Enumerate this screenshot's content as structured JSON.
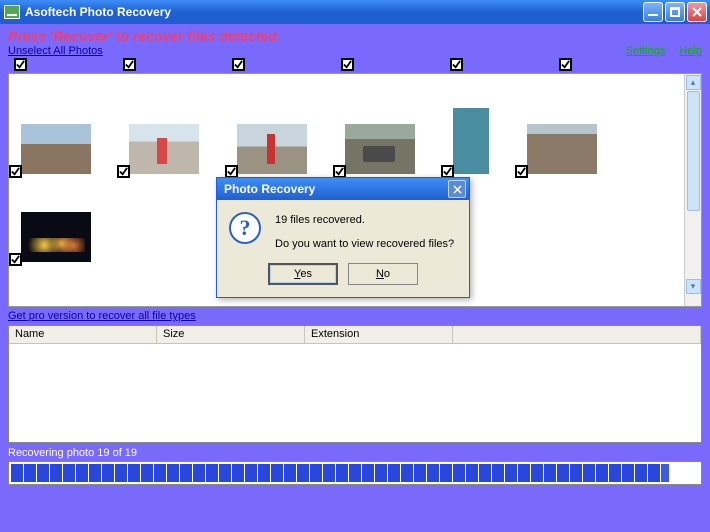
{
  "window": {
    "title": "Asoftech Photo Recovery"
  },
  "main": {
    "instruction": "Press 'Recover' to recover files detected.",
    "unselect_link": "Unselect All Photos",
    "settings_link": "Settings",
    "help_link": "Help",
    "pro_link": "Get pro version to recover all file types"
  },
  "grid": {
    "col_name": "Name",
    "col_size": "Size",
    "col_ext": "Extension"
  },
  "status": {
    "text": "Recovering photo 19 of 19"
  },
  "dialog": {
    "title": "Photo Recovery",
    "line1": "19 files recovered.",
    "line2": "Do you want to view recovered files?",
    "yes": "Yes",
    "no": "No"
  }
}
